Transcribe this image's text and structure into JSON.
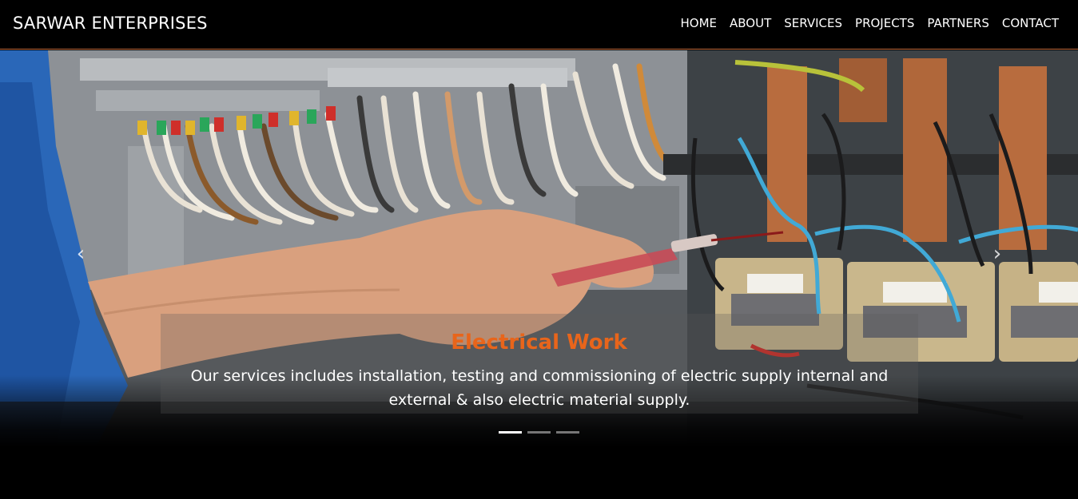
{
  "navbar": {
    "brand": "SARWAR ENTERPRISES",
    "links": [
      "HOME",
      "ABOUT",
      "SERVICES",
      "PROJECTS",
      "PARTNERS",
      "CONTACT"
    ]
  },
  "carousel": {
    "slide_title": "Electrical Work",
    "slide_text": "Our services includes installation, testing and commissioning of electric supply internal and external & also electric material supply.",
    "prev_icon": "chevron-left-icon",
    "next_icon": "chevron-right-icon",
    "indicator_count": 3,
    "active_index": 0
  },
  "colors": {
    "accent": "#e8651b",
    "nav_border": "#c2693a",
    "background": "#000000"
  }
}
